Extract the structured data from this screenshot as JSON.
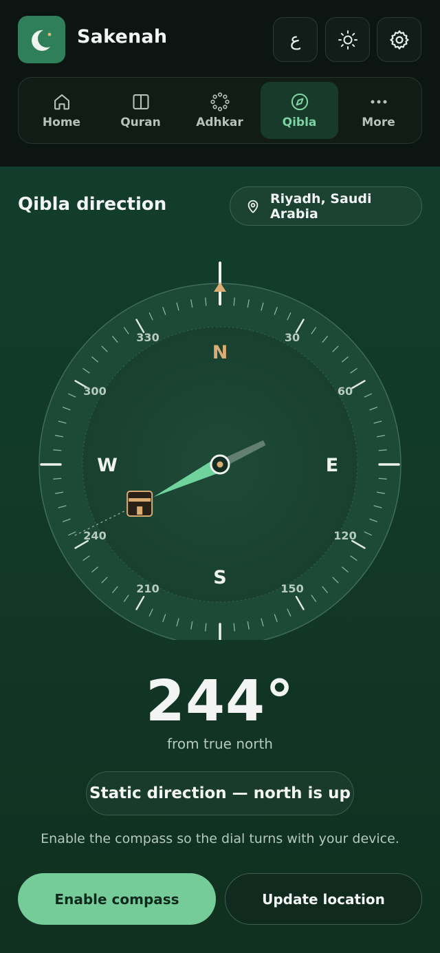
{
  "app": {
    "name": "Sakenah",
    "logo_icon": "crescent-moon-icon",
    "lang_button": "ع",
    "theme_icon": "sun-icon",
    "settings_icon": "gear-icon"
  },
  "nav": {
    "items": [
      {
        "label": "Home",
        "icon": "home-icon",
        "active": false
      },
      {
        "label": "Quran",
        "icon": "book-icon",
        "active": false
      },
      {
        "label": "Adhkar",
        "icon": "prayer-beads-icon",
        "active": false
      },
      {
        "label": "Qibla",
        "icon": "compass-icon",
        "active": true
      },
      {
        "label": "More",
        "icon": "more-dots-icon",
        "active": false
      }
    ]
  },
  "qibla": {
    "title": "Qibla direction",
    "location": "Riyadh, Saudi Arabia",
    "location_icon": "location-pin-icon",
    "bearing_degrees": 244,
    "bearing_text": "244°",
    "caption": "from true north",
    "mode": "Static direction — north is up",
    "hint": "Enable the compass so the dial turns with your device.",
    "kaaba_icon": "kaaba-icon"
  },
  "compass": {
    "cardinals": {
      "N": "N",
      "E": "E",
      "S": "S",
      "W": "W"
    },
    "degree_labels": [
      "30",
      "60",
      "120",
      "150",
      "210",
      "240",
      "300",
      "330"
    ]
  },
  "actions": {
    "enable_compass": "Enable compass",
    "update_location": "Update location"
  },
  "colors": {
    "accent": "#75cc99",
    "active_nav": "#7ed3a2",
    "north_marker": "#d9ad74",
    "background": "#123d2c"
  }
}
